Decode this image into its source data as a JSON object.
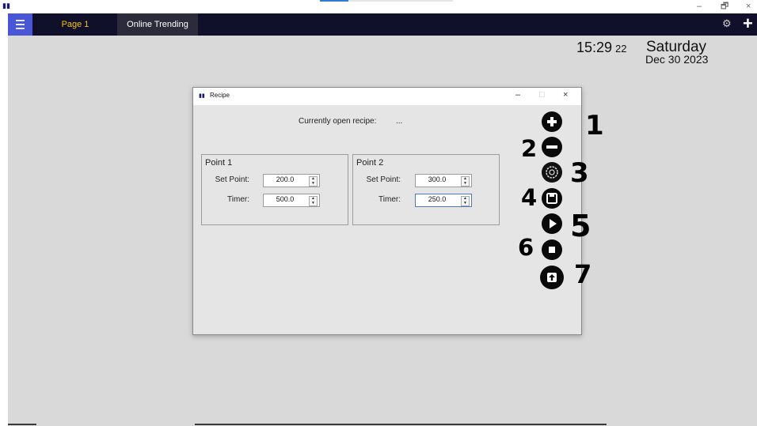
{
  "app": {
    "title_bar_icon": "app-logo-icon"
  },
  "window_controls": {
    "minimize": "–",
    "restore": "🗗",
    "close": "×"
  },
  "toolbar": {
    "menu_icon": "hamburger-icon",
    "tabs": [
      {
        "label": "Page 1",
        "active": true
      },
      {
        "label": "Online Trending",
        "active": false
      }
    ],
    "settings_icon": "gear-icon",
    "add_icon": "plus-icon"
  },
  "clock": {
    "time": "15:29",
    "seconds": "22",
    "day": "Saturday",
    "date": "Dec 30 2023"
  },
  "dialog": {
    "title": "Recipe",
    "controls": {
      "minimize": "–",
      "maximize": "□",
      "close": "×"
    },
    "open_recipe_label": "Currently open recipe:",
    "open_recipe_value": "...",
    "points": [
      {
        "title": "Point 1",
        "set_point_label": "Set Point:",
        "set_point_value": "200.0",
        "timer_label": "Timer:",
        "timer_value": "500.0"
      },
      {
        "title": "Point 2",
        "set_point_label": "Set Point:",
        "set_point_value": "300.0",
        "timer_label": "Timer:",
        "timer_value": "250.0"
      }
    ],
    "action_buttons": [
      {
        "icon": "add-circle-icon",
        "number": "1"
      },
      {
        "icon": "remove-circle-icon",
        "number": "2"
      },
      {
        "icon": "settings-gear-icon",
        "number": "3"
      },
      {
        "icon": "save-icon",
        "number": "4"
      },
      {
        "icon": "play-icon",
        "number": "5"
      },
      {
        "icon": "stop-icon",
        "number": "6"
      },
      {
        "icon": "upload-icon",
        "number": "7"
      }
    ]
  },
  "colors": {
    "accent": "#4a56d8",
    "active_tab_text": "#f2c200",
    "topbar_bg": "#10102a",
    "workspace_bg": "#d9d9d9"
  }
}
